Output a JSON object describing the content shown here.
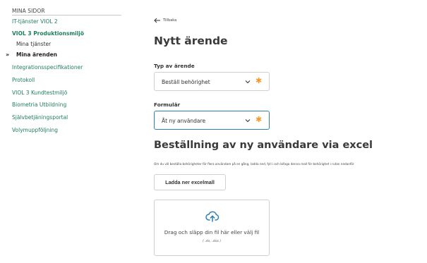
{
  "sidebar": {
    "heading": "MINA SIDOR",
    "items": [
      {
        "label": "IT-tjänster VIOL 2"
      },
      {
        "label": "VIOL 3 Produktionsmiljö"
      },
      {
        "label": "Mina tjänster"
      },
      {
        "label": "Mina ärenden"
      },
      {
        "label": "Integrationsspecifikationer"
      },
      {
        "label": "Protokoll"
      },
      {
        "label": "VIOL 3 Kundtestmiljö"
      },
      {
        "label": "Biometria Utbildning"
      },
      {
        "label": "Självbetjäningsportal"
      },
      {
        "label": "Volymuppföljning"
      }
    ],
    "active_marker": "»"
  },
  "main": {
    "back_label": "Tillbaka",
    "title": "Nytt ärende",
    "case_type": {
      "label": "Typ av ärende",
      "value": "Beställ behörighet"
    },
    "form": {
      "label": "Formulär",
      "value": "Åt ny användare"
    },
    "required_marker": "✱",
    "section_title": "Beställning av ny användare via excel",
    "section_desc": "Om du vill beställa behörigheter för flera användare på en gång, ladda ned, fyll i och bifoga denna mall för behörighet i rutan nedanför",
    "download_label": "Ladda ner excelmall",
    "dropzone": {
      "text": "Drag och släpp din fil här eller välj fil",
      "hint": "( .xls, .xlsx )"
    }
  },
  "colors": {
    "link": "#1e7e5c",
    "accent": "#2f7fb2",
    "required": "#f29a2e"
  }
}
